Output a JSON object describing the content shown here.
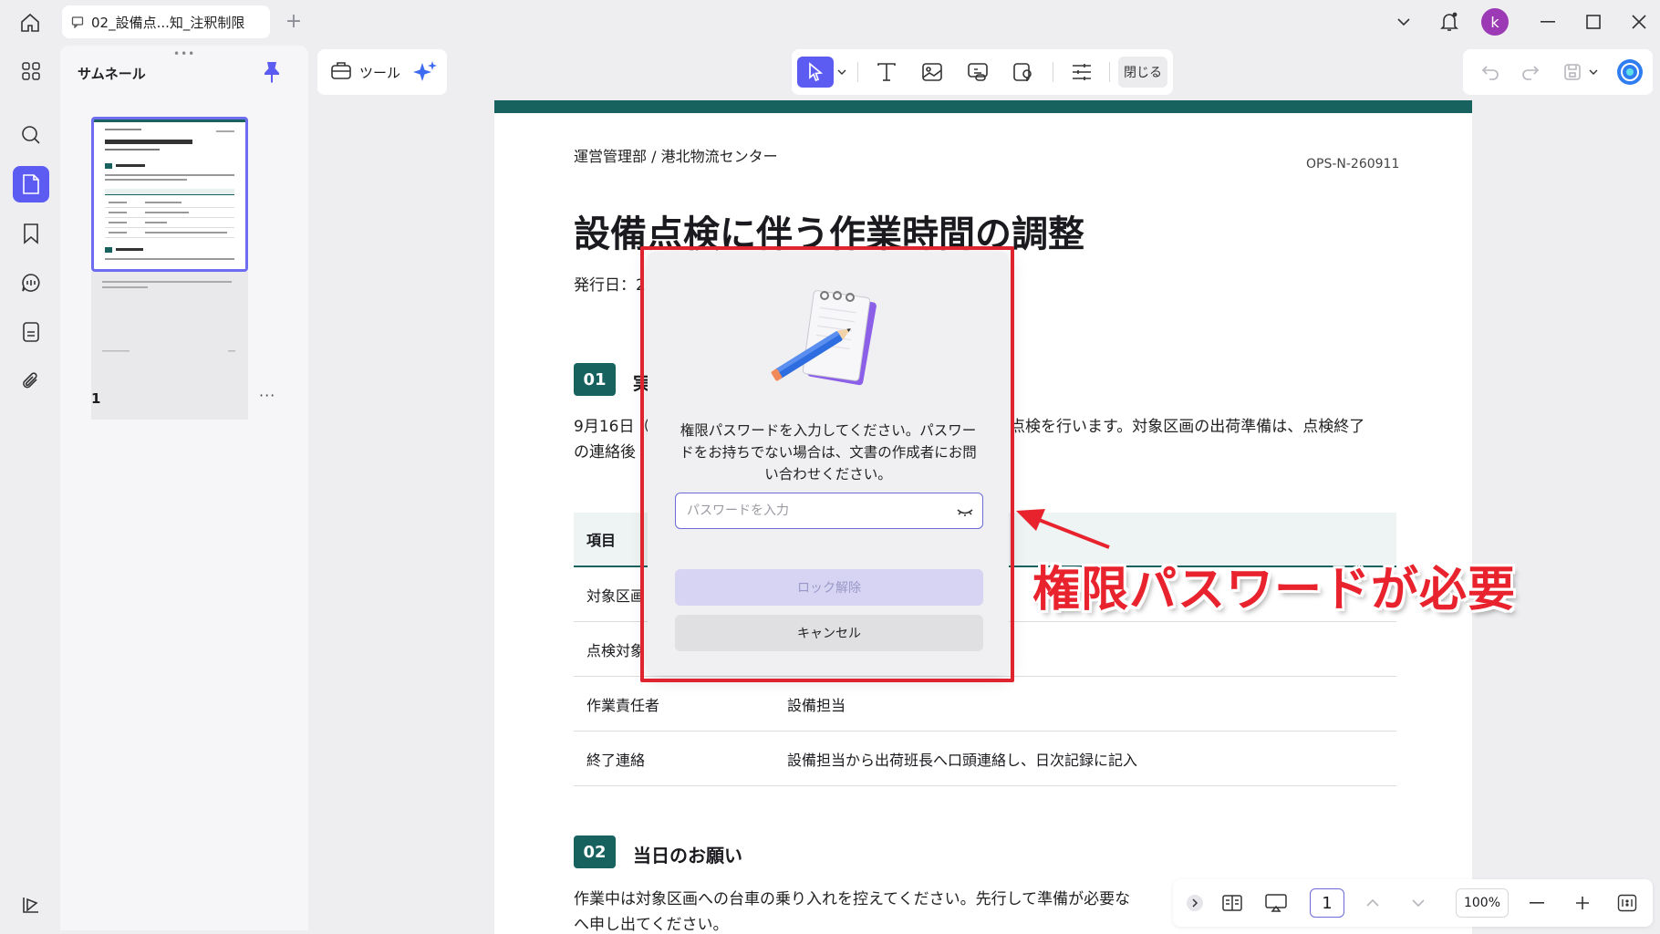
{
  "titlebar": {
    "tab_title": "02_設備点...知_注釈制限",
    "avatar_letter": "k"
  },
  "thumbs": {
    "title": "サムネール",
    "page_number": "1",
    "more": "···"
  },
  "toolbar": {
    "tools_label": "ツール",
    "close_label": "閉じる"
  },
  "document": {
    "department": "運営管理部 / 港北物流センター",
    "doc_id": "OPS-N-260911",
    "title": "設備点検に伴う作業時間の調整",
    "issued_visible": "発行日：2",
    "section1": {
      "number": "01",
      "title_visible": "実"
    },
    "para1_line1_left": "9月16日（",
    "para1_line1_right": "点検を行います。対象区画の出荷準備は、点検終了",
    "para1_line2_left": "の連絡後",
    "table": {
      "header": "項目",
      "rows": [
        {
          "item": "対象区画",
          "value": ""
        },
        {
          "item": "点検対象",
          "value": ""
        },
        {
          "item": "作業責任者",
          "value": "設備担当"
        },
        {
          "item": "終了連絡",
          "value": "設備担当から出荷班長へ口頭連絡し、日次記録に記入"
        }
      ]
    },
    "section2": {
      "number": "02",
      "title": "当日のお願い"
    },
    "para2": "作業中は対象区画への台車の乗り入れを控えてください。先行して準備が必要な",
    "para2_line2": "へ申し出てください。"
  },
  "modal": {
    "message": "権限パスワードを入力してください。パスワードをお持ちでない場合は、文書の作成者にお問い合わせください。",
    "password_placeholder": "パスワードを入力",
    "unlock_label": "ロック解除",
    "cancel_label": "キャンセル"
  },
  "annotation": {
    "text": "権限パスワードが必要",
    "color": "#e8232d"
  },
  "bottombar": {
    "page": "1",
    "zoom": "100%"
  },
  "colors": {
    "accent": "#5d5cf2",
    "doc_teal": "#17615e",
    "highlight_red": "#e0242f"
  }
}
